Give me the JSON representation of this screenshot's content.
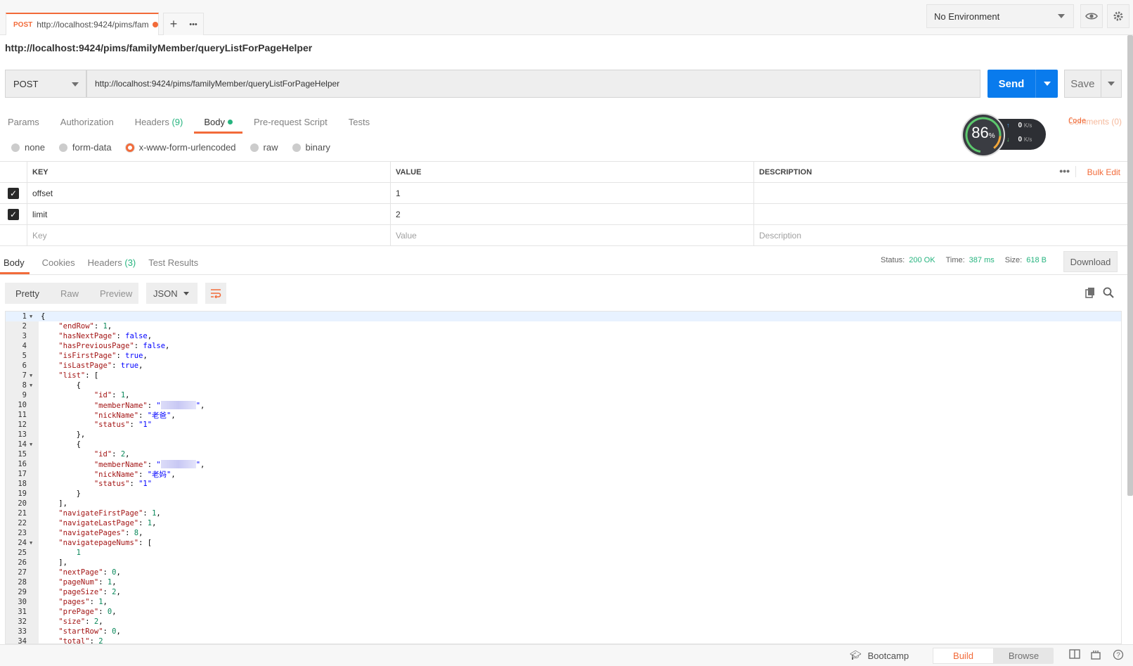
{
  "tab": {
    "method": "POST",
    "url": "http://localhost:9424/pims/fam",
    "new_tab_label": "+",
    "more_label": "•••"
  },
  "environment": {
    "selected": "No Environment"
  },
  "request": {
    "title": "http://localhost:9424/pims/familyMember/queryListForPageHelper",
    "method": "POST",
    "url": "http://localhost:9424/pims/familyMember/queryListForPageHelper",
    "send_label": "Send",
    "save_label": "Save"
  },
  "request_tabs": [
    {
      "label": "Params"
    },
    {
      "label": "Authorization"
    },
    {
      "label": "Headers",
      "count": "(9)"
    },
    {
      "label": "Body"
    },
    {
      "label": "Pre-request Script"
    },
    {
      "label": "Tests"
    }
  ],
  "right_links": {
    "code": "Code",
    "comments": "Comments (0)"
  },
  "net_widget": {
    "percent": "86",
    "unit": "%",
    "up": "0",
    "down": "0",
    "rate_unit": "K/s"
  },
  "body_types": [
    "none",
    "form-data",
    "x-www-form-urlencoded",
    "raw",
    "binary"
  ],
  "body_type_selected": "x-www-form-urlencoded",
  "params_table": {
    "headers": {
      "key": "KEY",
      "value": "VALUE",
      "description": "DESCRIPTION",
      "bulk_edit": "Bulk Edit",
      "more": "•••"
    },
    "rows": [
      {
        "key": "offset",
        "value": "1",
        "description": "",
        "checked": true
      },
      {
        "key": "limit",
        "value": "2",
        "description": "",
        "checked": true
      }
    ],
    "placeholder": {
      "key": "Key",
      "value": "Value",
      "description": "Description"
    }
  },
  "response_tabs": [
    {
      "label": "Body"
    },
    {
      "label": "Cookies"
    },
    {
      "label": "Headers",
      "count": "(3)"
    },
    {
      "label": "Test Results"
    }
  ],
  "response_meta": {
    "status_label": "Status:",
    "status": "200 OK",
    "time_label": "Time:",
    "time": "387 ms",
    "size_label": "Size:",
    "size": "618 B",
    "download": "Download"
  },
  "viewer": {
    "modes": [
      "Pretty",
      "Raw",
      "Preview"
    ],
    "active_mode": "Pretty",
    "format": "JSON"
  },
  "code_lines": [
    "{",
    "    \"endRow\": 1,",
    "    \"hasNextPage\": false,",
    "    \"hasPreviousPage\": false,",
    "    \"isFirstPage\": true,",
    "    \"isLastPage\": true,",
    "    \"list\": [",
    "        {",
    "            \"id\": 1,",
    "            \"memberName\": \"░░░\",",
    "            \"nickName\": \"老爸\",",
    "            \"status\": \"1\"",
    "        },",
    "        {",
    "            \"id\": 2,",
    "            \"memberName\": \"░░░\",",
    "            \"nickName\": \"老妈\",",
    "            \"status\": \"1\"",
    "        }",
    "    ],",
    "    \"navigateFirstPage\": 1,",
    "    \"navigateLastPage\": 1,",
    "    \"navigatePages\": 8,",
    "    \"navigatepageNums\": [",
    "        1",
    "    ],",
    "    \"nextPage\": 0,",
    "    \"pageNum\": 1,",
    "    \"pageSize\": 2,",
    "    \"pages\": 1,",
    "    \"prePage\": 0,",
    "    \"size\": 2,",
    "    \"startRow\": 0,",
    "    \"total\": 2"
  ],
  "folded_lines": [
    1,
    7,
    8,
    14,
    24
  ],
  "footer": {
    "bootcamp": "Bootcamp",
    "build": "Build",
    "browse": "Browse"
  }
}
